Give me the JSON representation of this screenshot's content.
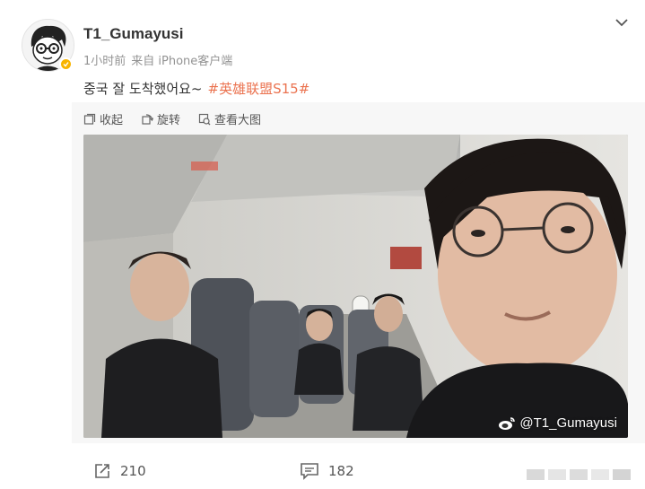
{
  "post": {
    "username": "T1_Gumayusi",
    "time": "1小时前",
    "source": "来自 iPhone客户端",
    "text": "중국 잘 도착했어요~",
    "hashtag": "#英雄联盟S15#"
  },
  "toolbar": {
    "collect_label": "收起",
    "rotate_label": "旋转",
    "view_large_label": "查看大图"
  },
  "photo": {
    "watermark": "@T1_Gumayusi"
  },
  "footer": {
    "repost_count": "210",
    "comment_count": "182"
  },
  "colors": {
    "hashtag": "#eb7350",
    "verified": "#f8b400",
    "meta": "#939393"
  },
  "icons": [
    "chevron-down-icon",
    "collapse-icon",
    "rotate-icon",
    "view-large-icon",
    "repost-icon",
    "comment-icon",
    "weibo-icon",
    "verified-icon"
  ]
}
